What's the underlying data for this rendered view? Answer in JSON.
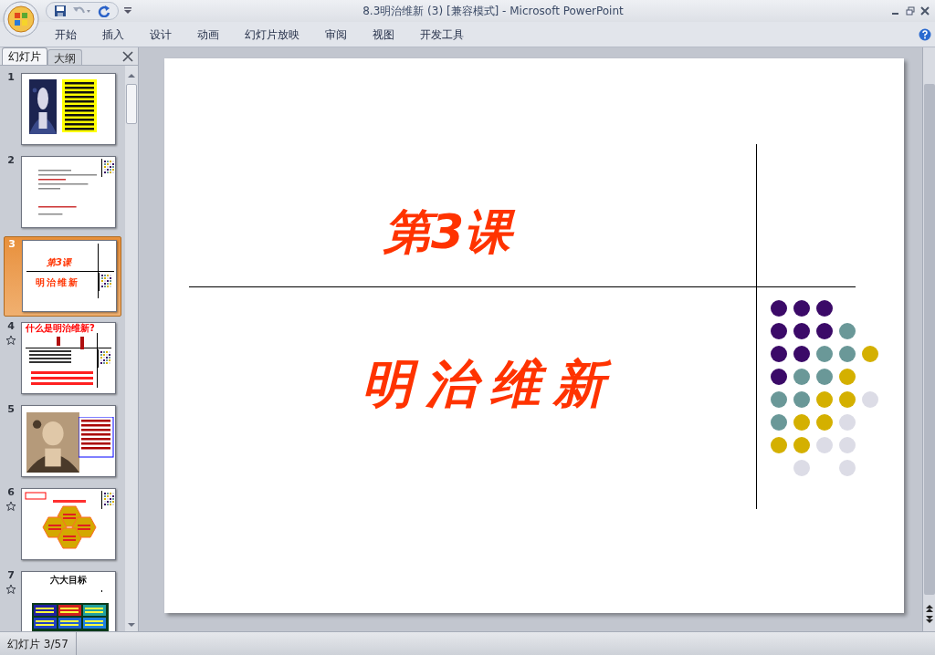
{
  "window": {
    "title": "8.3明治维新 (3) [兼容模式] - Microsoft PowerPoint"
  },
  "ribbon_tabs": [
    {
      "label": "开始"
    },
    {
      "label": "插入"
    },
    {
      "label": "设计"
    },
    {
      "label": "动画"
    },
    {
      "label": "幻灯片放映"
    },
    {
      "label": "审阅"
    },
    {
      "label": "视图"
    },
    {
      "label": "开发工具"
    }
  ],
  "panel_tabs": [
    {
      "label": "幻灯片",
      "selected": true
    },
    {
      "label": "大纲",
      "selected": false
    }
  ],
  "thumbnails": [
    {
      "number": "1",
      "selected": false,
      "animated": false,
      "kind": "photo-text"
    },
    {
      "number": "2",
      "selected": false,
      "animated": false,
      "kind": "text"
    },
    {
      "number": "3",
      "selected": true,
      "animated": false,
      "kind": "title",
      "title": "第3课",
      "subtitle": "明治维新"
    },
    {
      "number": "4",
      "selected": false,
      "animated": true,
      "kind": "diagram",
      "title": "什么是明治维新?"
    },
    {
      "number": "5",
      "selected": false,
      "animated": false,
      "kind": "photo-text"
    },
    {
      "number": "6",
      "selected": false,
      "animated": true,
      "kind": "hexagons"
    },
    {
      "number": "7",
      "selected": false,
      "animated": true,
      "kind": "table",
      "title": "六大目标"
    }
  ],
  "slide": {
    "title": "第3课",
    "subtitle": "明治维新",
    "dot_grid": [
      {
        "cells": [
          {
            "kind": "dot",
            "color": "#3b0a68"
          },
          {
            "kind": "dot",
            "color": "#3b0a68"
          },
          {
            "kind": "dot",
            "color": "#3b0a68"
          }
        ]
      },
      {
        "cells": [
          {
            "kind": "dot",
            "color": "#3b0a68"
          },
          {
            "kind": "dot",
            "color": "#3b0a68"
          },
          {
            "kind": "dot",
            "color": "#3b0a68"
          },
          {
            "kind": "dot",
            "color": "#6a9898"
          }
        ]
      },
      {
        "cells": [
          {
            "kind": "dot",
            "color": "#3b0a68"
          },
          {
            "kind": "dot",
            "color": "#3b0a68"
          },
          {
            "kind": "dot",
            "color": "#6a9898"
          },
          {
            "kind": "dot",
            "color": "#6a9898"
          },
          {
            "kind": "dot",
            "color": "#d4b000"
          }
        ]
      },
      {
        "cells": [
          {
            "kind": "dot",
            "color": "#3b0a68"
          },
          {
            "kind": "dot",
            "color": "#6a9898"
          },
          {
            "kind": "dot",
            "color": "#6a9898"
          },
          {
            "kind": "dot",
            "color": "#d4b000"
          }
        ]
      },
      {
        "cells": [
          {
            "kind": "dot",
            "color": "#6a9898"
          },
          {
            "kind": "dot",
            "color": "#6a9898"
          },
          {
            "kind": "dot",
            "color": "#d4b000"
          },
          {
            "kind": "dot",
            "color": "#d4b000"
          },
          {
            "kind": "dot",
            "color": "#dcdce6"
          }
        ]
      },
      {
        "cells": [
          {
            "kind": "dot",
            "color": "#6a9898"
          },
          {
            "kind": "dot",
            "color": "#d4b000"
          },
          {
            "kind": "dot",
            "color": "#d4b000"
          },
          {
            "kind": "dot",
            "color": "#dcdce6"
          }
        ]
      },
      {
        "cells": [
          {
            "kind": "dot",
            "color": "#d4b000"
          },
          {
            "kind": "dot",
            "color": "#d4b000"
          },
          {
            "kind": "dot",
            "color": "#dcdce6"
          },
          {
            "kind": "dot",
            "color": "#dcdce6"
          }
        ]
      },
      {
        "cells": [
          {
            "kind": "empty"
          },
          {
            "kind": "dot",
            "color": "#dcdce6"
          },
          {
            "kind": "empty"
          },
          {
            "kind": "dot",
            "color": "#dcdce6"
          }
        ]
      }
    ]
  },
  "status_bar": {
    "slide_count": "幻灯片 3/57"
  }
}
